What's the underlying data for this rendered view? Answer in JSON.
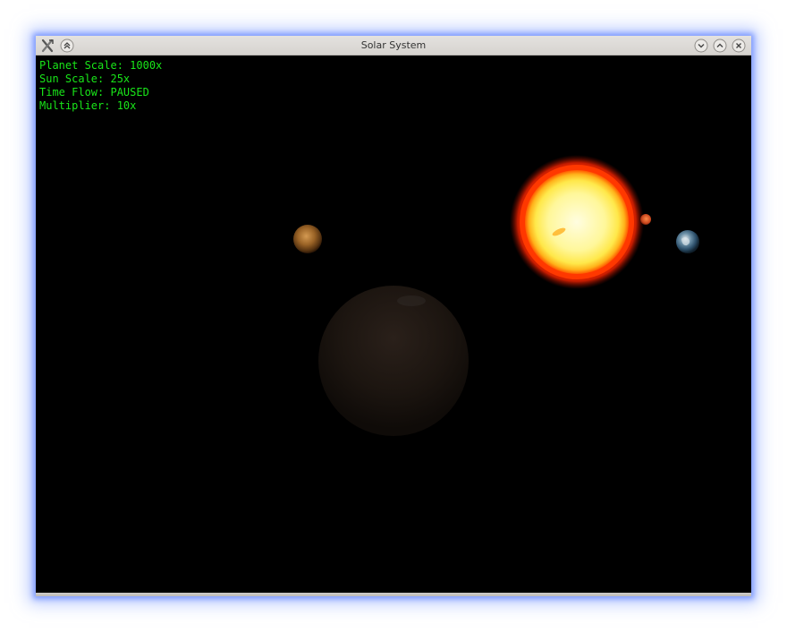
{
  "window": {
    "title": "Solar System",
    "controls": {
      "app_icon": "x-tools-icon",
      "shade": "chevron-double-up-icon",
      "minimize": "chevron-down-icon",
      "maximize": "chevron-up-icon",
      "close": "close-icon"
    }
  },
  "hud": {
    "planet_scale": "Planet Scale: 1000x",
    "sun_scale": "Sun Scale: 25x",
    "time_flow": "Time Flow: PAUSED",
    "multiplier": "Multiplier: 10x",
    "color": "#19e619"
  },
  "scene": {
    "background": "#000000",
    "bodies": [
      "sun",
      "earth",
      "mercury",
      "mars",
      "venus"
    ]
  }
}
